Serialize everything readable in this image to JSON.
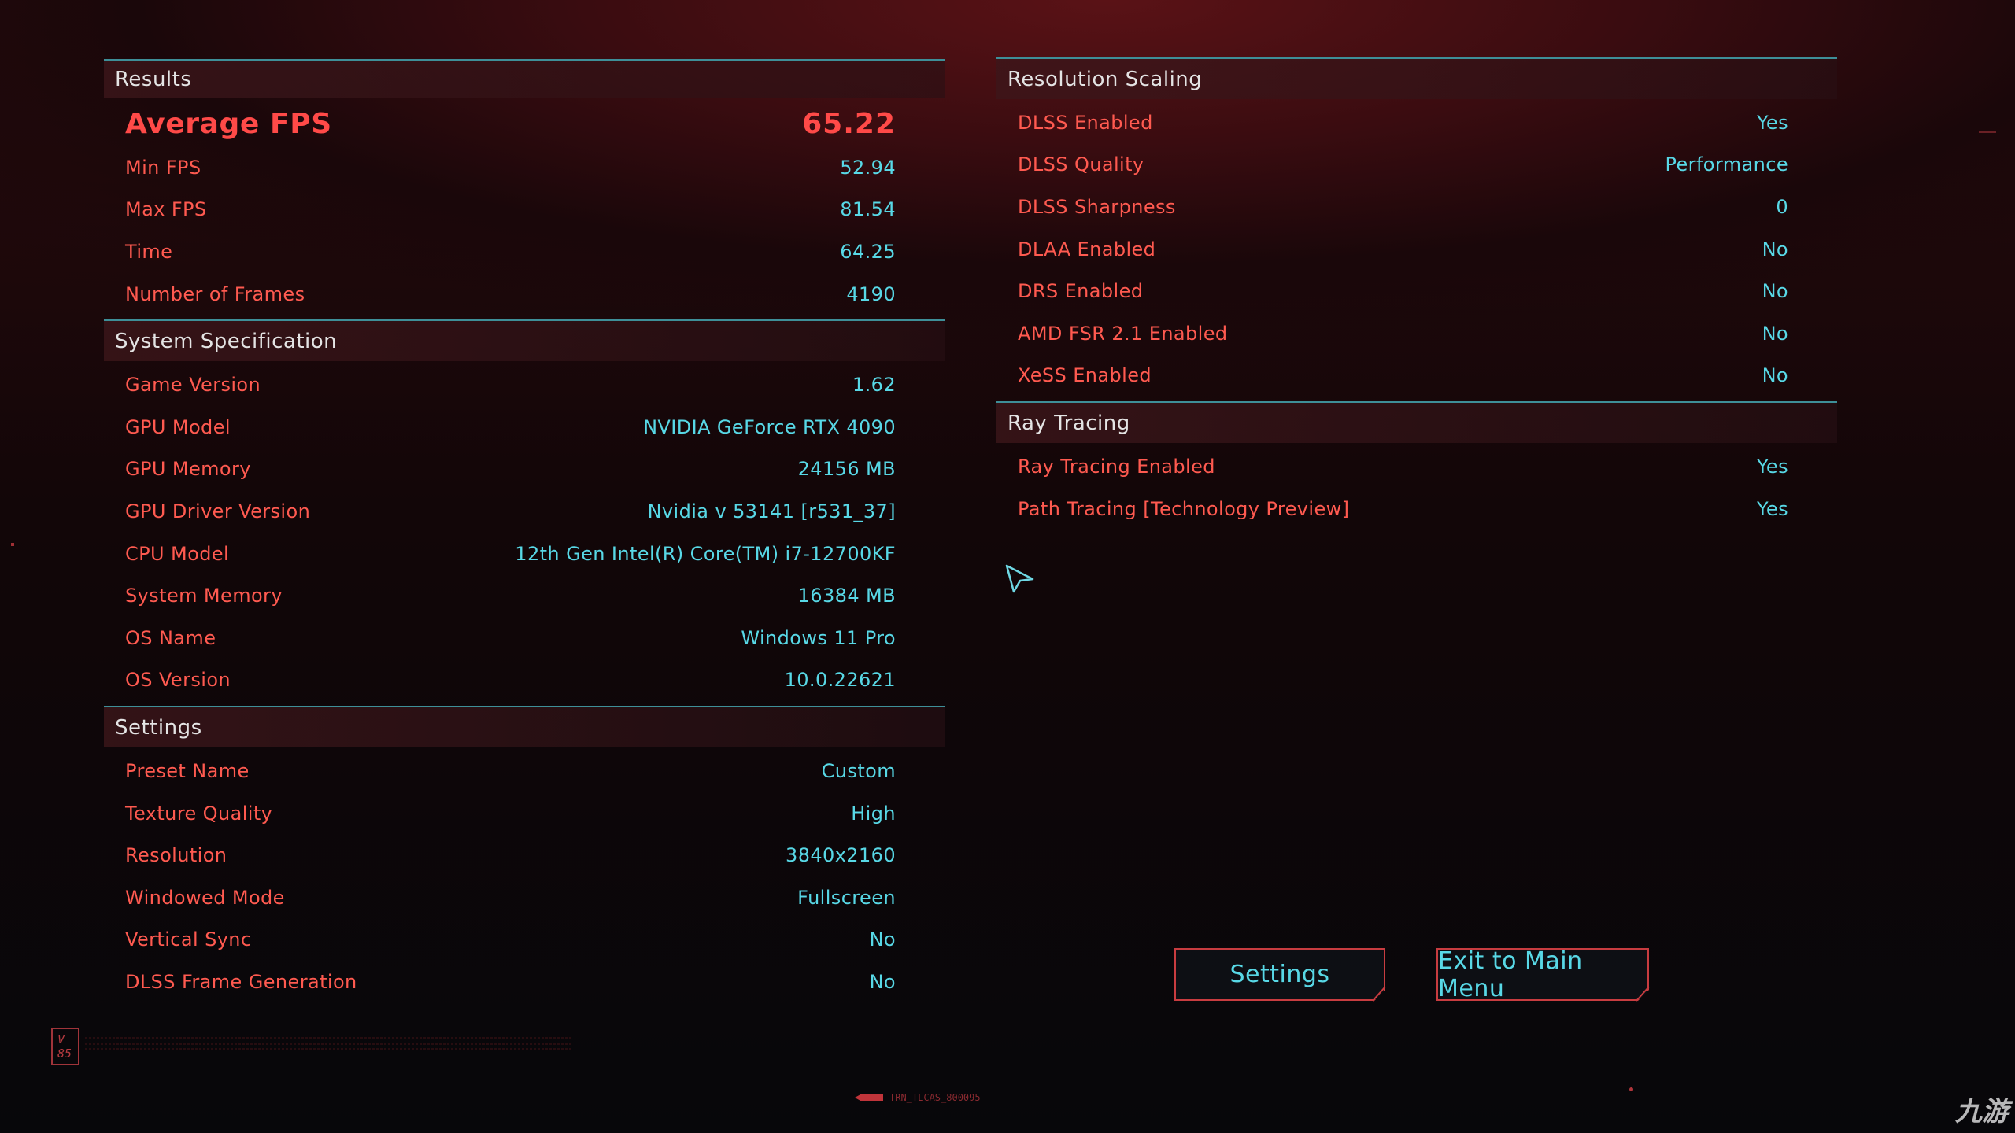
{
  "results": {
    "header": "Results",
    "average_fps": {
      "label": "Average FPS",
      "value": "65.22"
    },
    "rows": [
      {
        "label": "Min FPS",
        "value": "52.94"
      },
      {
        "label": "Max FPS",
        "value": "81.54"
      },
      {
        "label": "Time",
        "value": "64.25"
      },
      {
        "label": "Number of Frames",
        "value": "4190"
      }
    ]
  },
  "system_specification": {
    "header": "System Specification",
    "rows": [
      {
        "label": "Game Version",
        "value": "1.62"
      },
      {
        "label": "GPU Model",
        "value": "NVIDIA GeForce RTX 4090"
      },
      {
        "label": "GPU Memory",
        "value": "24156 MB"
      },
      {
        "label": "GPU Driver Version",
        "value": "Nvidia v 53141 [r531_37]"
      },
      {
        "label": "CPU Model",
        "value": "12th Gen Intel(R) Core(TM) i7-12700KF"
      },
      {
        "label": "System Memory",
        "value": "16384 MB"
      },
      {
        "label": "OS Name",
        "value": "Windows 11 Pro"
      },
      {
        "label": "OS Version",
        "value": "10.0.22621"
      }
    ]
  },
  "settings": {
    "header": "Settings",
    "rows": [
      {
        "label": "Preset Name",
        "value": "Custom"
      },
      {
        "label": "Texture Quality",
        "value": "High"
      },
      {
        "label": "Resolution",
        "value": "3840x2160"
      },
      {
        "label": "Windowed Mode",
        "value": "Fullscreen"
      },
      {
        "label": "Vertical Sync",
        "value": "No"
      },
      {
        "label": "DLSS Frame Generation",
        "value": "No"
      }
    ]
  },
  "resolution_scaling": {
    "header": "Resolution Scaling",
    "rows": [
      {
        "label": "DLSS Enabled",
        "value": "Yes"
      },
      {
        "label": "DLSS Quality",
        "value": "Performance"
      },
      {
        "label": "DLSS Sharpness",
        "value": "0"
      },
      {
        "label": "DLAA Enabled",
        "value": "No"
      },
      {
        "label": "DRS Enabled",
        "value": "No"
      },
      {
        "label": "AMD FSR 2.1 Enabled",
        "value": "No"
      },
      {
        "label": "XeSS Enabled",
        "value": "No"
      }
    ]
  },
  "ray_tracing": {
    "header": "Ray Tracing",
    "rows": [
      {
        "label": "Ray Tracing Enabled",
        "value": "Yes"
      },
      {
        "label": "Path Tracing [Technology Preview]",
        "value": "Yes"
      }
    ]
  },
  "buttons": {
    "settings_label": "Settings",
    "exit_label": "Exit to Main Menu"
  },
  "footer": {
    "version_badge": "V\n85",
    "build_id": "TRN_TLCAS_800095",
    "watermark": "九游"
  },
  "colors": {
    "label_red": "#ff5a50",
    "value_cyan": "#58d8e6",
    "divider_teal": "#3e8f98",
    "button_border": "#c83c40"
  },
  "icons": {
    "cursor": "arrow-pointer-icon"
  }
}
